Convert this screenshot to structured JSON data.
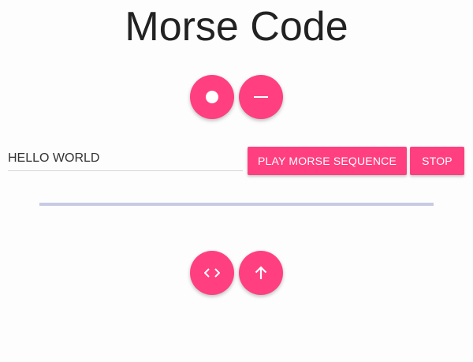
{
  "header": {
    "title": "Morse Code"
  },
  "morse_buttons": {
    "dot_icon": "dot-icon",
    "dash_icon": "dash-icon"
  },
  "input": {
    "value": "HELLO WORLD"
  },
  "actions": {
    "play_label": "PLAY MORSE SEQUENCE",
    "stop_label": "STOP"
  },
  "progress": {
    "value": 0
  },
  "bottom_buttons": {
    "code_icon": "code-icon",
    "up_icon": "arrow-up-icon"
  },
  "colors": {
    "accent": "#ff3f80",
    "progress_track": "#c7cae2",
    "progress_fill": "#3f51b5"
  }
}
